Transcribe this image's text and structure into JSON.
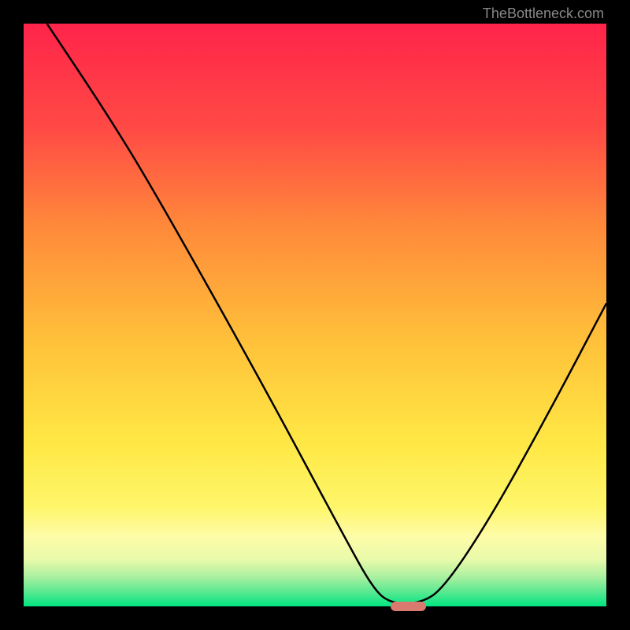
{
  "attribution": "TheBottleneck.com",
  "chart_data": {
    "type": "line",
    "title": "",
    "xlabel": "",
    "ylabel": "",
    "xlim": [
      0,
      100
    ],
    "ylim": [
      0,
      100
    ],
    "gradient_colors": {
      "top": "#ff244a",
      "upper_mid": "#ff7a3a",
      "mid": "#ffc23a",
      "lower_mid": "#ffe845",
      "light_yellow": "#fef98f",
      "pale_green": "#b8f5a8",
      "green": "#00e582"
    },
    "curve_points": [
      {
        "x": 4,
        "y": 100
      },
      {
        "x": 14,
        "y": 85
      },
      {
        "x": 22,
        "y": 72
      },
      {
        "x": 40,
        "y": 40
      },
      {
        "x": 55,
        "y": 12
      },
      {
        "x": 60,
        "y": 3
      },
      {
        "x": 63,
        "y": 0.5
      },
      {
        "x": 68,
        "y": 0.5
      },
      {
        "x": 72,
        "y": 3
      },
      {
        "x": 80,
        "y": 15
      },
      {
        "x": 90,
        "y": 33
      },
      {
        "x": 100,
        "y": 52
      }
    ],
    "marker": {
      "x_start": 63,
      "x_end": 69,
      "y": 0,
      "color": "#d87a6e"
    }
  }
}
